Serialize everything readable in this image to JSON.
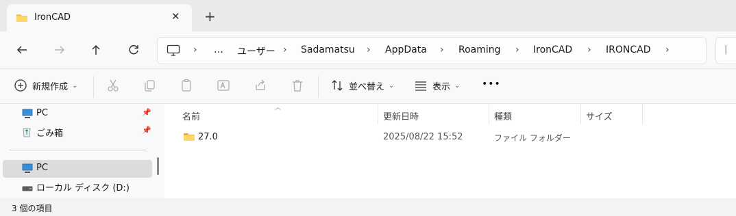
{
  "tab": {
    "title": "IronCAD",
    "close": "✕",
    "new_tab": "+"
  },
  "breadcrumb": {
    "overflow": "…",
    "separator": "›",
    "items": [
      "ユーザー",
      "Sadamatsu",
      "AppData",
      "Roaming",
      "IronCAD",
      "IRONCAD"
    ]
  },
  "toolbar": {
    "new_label": "新規作成",
    "sort_label": "並べ替え",
    "view_label": "表示",
    "more": "•••"
  },
  "sidebar": {
    "items": [
      {
        "label": "PC",
        "icon": "pc-icon",
        "pinned": true
      },
      {
        "label": "ごみ箱",
        "icon": "recycle-bin-icon",
        "pinned": true
      },
      {
        "label": "PC",
        "icon": "pc-icon",
        "selected": true
      },
      {
        "label": "ローカル ディスク (D:)",
        "icon": "drive-icon"
      }
    ]
  },
  "columns": {
    "name": "名前",
    "modified": "更新日時",
    "type": "種類",
    "size": "サイズ"
  },
  "files": [
    {
      "name": "27.0",
      "modified": "2025/08/22 15:52",
      "type": "ファイル フォルダー",
      "size": ""
    }
  ],
  "status": {
    "text": "3 個の項目"
  },
  "colors": {
    "folder": "#f4c64a",
    "accent": "#0067c0",
    "selection": "#dcdcdc"
  }
}
